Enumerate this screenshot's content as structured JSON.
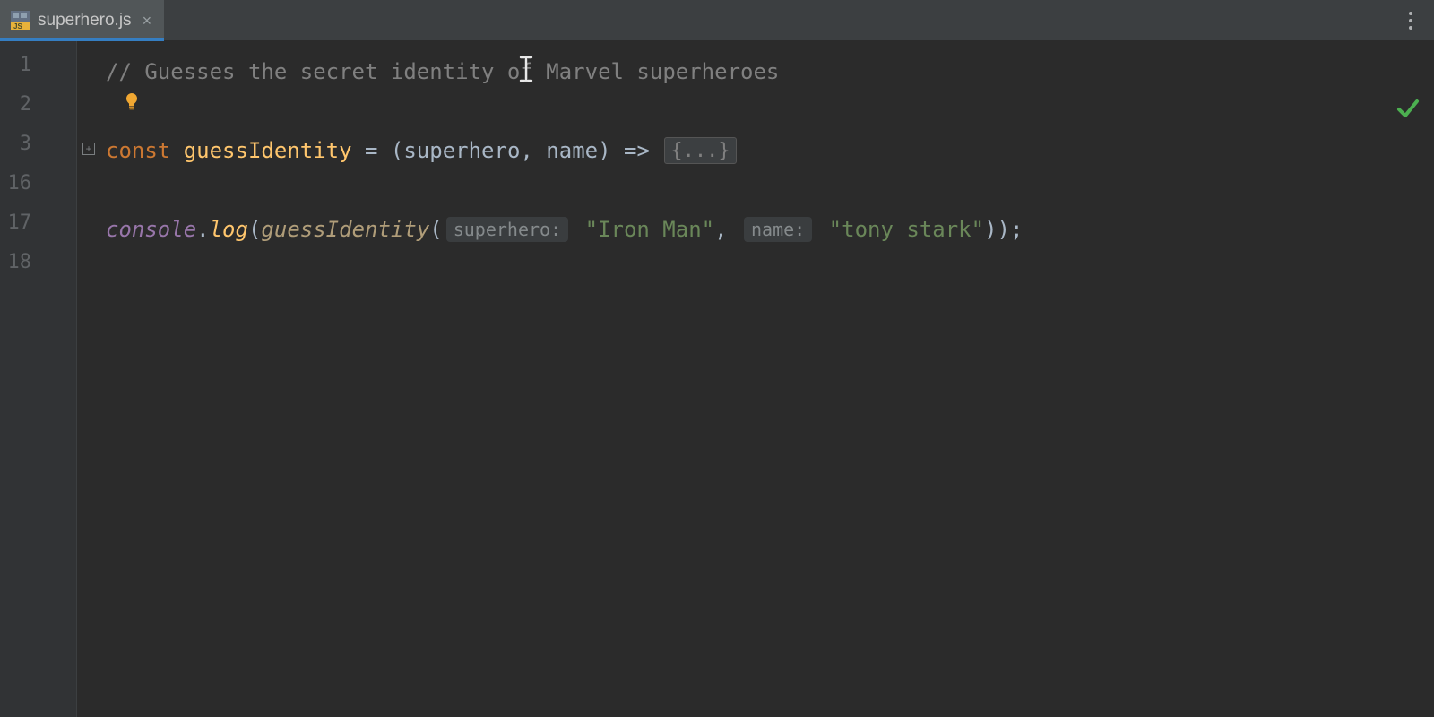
{
  "tab": {
    "file_name": "superhero.js",
    "icon": "js-file-icon",
    "close": "×"
  },
  "gutter": {
    "line_numbers": [
      "1",
      "2",
      "3",
      "16",
      "17",
      "18"
    ]
  },
  "code": {
    "l1_comment": "// Guesses the secret identity of Marvel superheroes",
    "l3_const": "const ",
    "l3_fn_name": "guessIdentity",
    "l3_eq": " = ",
    "l3_params": "(superhero, name) => ",
    "l3_fold": "{...}",
    "l17_console": "console",
    "l17_dot": ".",
    "l17_log": "log",
    "l17_open": "(",
    "l17_call": "guessIdentity",
    "l17_open2": "(",
    "l17_inlay_superhero": "superhero:",
    "l17_str1": "\"Iron Man\"",
    "l17_comma": ", ",
    "l17_inlay_name": "name:",
    "l17_str2": "\"tony stark\"",
    "l17_close": "));"
  },
  "icons": {
    "bulb": "intention-bulb-icon",
    "fold_plus": "+",
    "check": "analysis-ok-icon",
    "kebab": "more-options-icon",
    "caret": "text-cursor-icon"
  },
  "colors": {
    "tab_underline": "#357ec2",
    "keyword": "#cc7832",
    "function": "#ffc66d",
    "string": "#6a8759",
    "comment": "#808080",
    "bulb": "#f0a732",
    "check": "#4caf50"
  }
}
